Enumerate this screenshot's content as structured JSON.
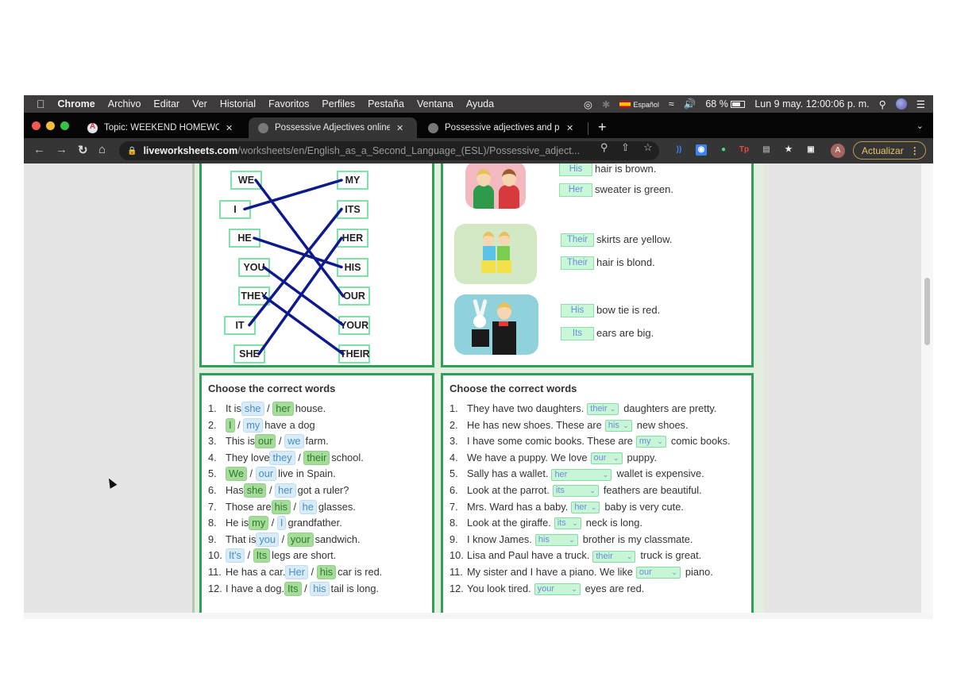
{
  "menubar": {
    "app": "Chrome",
    "items": [
      "Archivo",
      "Editar",
      "Ver",
      "Historial",
      "Favoritos",
      "Perfiles",
      "Pestaña",
      "Ventana",
      "Ayuda"
    ],
    "input_language": "Español",
    "battery": "68 %",
    "datetime": "Lun 9 may. 12:00:06 p. m."
  },
  "tabs": [
    {
      "title": "Topic: WEEKEND HOMEWORK",
      "active": false
    },
    {
      "title": "Possessive Adjectives online e",
      "active": true
    },
    {
      "title": "Possessive adjectives and pron",
      "active": false
    }
  ],
  "browser": {
    "url_host": "liveworksheets.com",
    "url_path": "/worksheets/en/English_as_a_Second_Language_(ESL)/Possessive_adject...",
    "update_label": "Actualizar",
    "avatar_initial": "A"
  },
  "matching": {
    "left": [
      "WE",
      "I",
      "HE",
      "YOU",
      "THEY",
      "IT",
      "SHE"
    ],
    "right": [
      "MY",
      "ITS",
      "HER",
      "HIS",
      "OUR",
      "YOUR",
      "THEIR"
    ],
    "pairs": [
      [
        "WE",
        "OUR"
      ],
      [
        "I",
        "MY"
      ],
      [
        "HE",
        "HIS"
      ],
      [
        "YOU",
        "YOUR"
      ],
      [
        "THEY",
        "THEIR"
      ],
      [
        "IT",
        "ITS"
      ],
      [
        "SHE",
        "HER"
      ]
    ],
    "line_color": "#0d1a8c"
  },
  "pictures": [
    {
      "answer": "His",
      "text": "hair is brown."
    },
    {
      "answer": "Her",
      "text": "sweater is green."
    },
    {
      "answer": "Their",
      "text": "skirts are yellow."
    },
    {
      "answer": "Their",
      "text": "hair is blond."
    },
    {
      "answer": "His",
      "text": "bow tie is red."
    },
    {
      "answer": "Its",
      "text": "ears are big."
    }
  ],
  "choose_left": {
    "title": "Choose the correct words",
    "items": [
      {
        "num": "1.",
        "pre": "It is",
        "a": "she",
        "a_sel": false,
        "b": "her",
        "b_sel": true,
        "post": "house."
      },
      {
        "num": "2.",
        "pre": "",
        "a": "I",
        "a_sel": true,
        "b": "my",
        "b_sel": false,
        "post": "have a dog"
      },
      {
        "num": "3.",
        "pre": "This is",
        "a": "our",
        "a_sel": true,
        "b": "we",
        "b_sel": false,
        "post": "farm."
      },
      {
        "num": "4.",
        "pre": "They love",
        "a": "they",
        "a_sel": false,
        "b": "their",
        "b_sel": true,
        "post": "school."
      },
      {
        "num": "5.",
        "pre": "",
        "a": "We",
        "a_sel": true,
        "b": "our",
        "b_sel": false,
        "post": "live in Spain."
      },
      {
        "num": "6.",
        "pre": "Has",
        "a": "she",
        "a_sel": true,
        "b": "her",
        "b_sel": false,
        "post": "got a ruler?"
      },
      {
        "num": "7.",
        "pre": "Those are",
        "a": "his",
        "a_sel": true,
        "b": "he",
        "b_sel": false,
        "post": "glasses."
      },
      {
        "num": "8.",
        "pre": "He is",
        "a": "my",
        "a_sel": true,
        "b": "I",
        "b_sel": false,
        "post": "grandfather."
      },
      {
        "num": "9.",
        "pre": "That is",
        "a": "you",
        "a_sel": false,
        "b": "your",
        "b_sel": true,
        "post": "sandwich."
      },
      {
        "num": "10.",
        "pre": "",
        "a": "It's",
        "a_sel": false,
        "b": "Its",
        "b_sel": true,
        "post": "legs are short."
      },
      {
        "num": "11.",
        "pre": "He has a car.",
        "a": "Her",
        "a_sel": false,
        "b": "his",
        "b_sel": true,
        "post": "car is red."
      },
      {
        "num": "12.",
        "pre": "I have a dog.",
        "a": "Its",
        "a_sel": true,
        "b": "his",
        "b_sel": false,
        "post": "tail is long."
      }
    ]
  },
  "choose_right": {
    "title": "Choose the correct words",
    "items": [
      {
        "num": "1.",
        "pre": "They have two daughters.",
        "value": "their",
        "post": "daughters are pretty."
      },
      {
        "num": "2.",
        "pre": "He has new shoes. These are",
        "value": "his",
        "post": "new shoes."
      },
      {
        "num": "3.",
        "pre": "I have some comic books. These are",
        "value": "my",
        "post": "comic books."
      },
      {
        "num": "4.",
        "pre": "We have a puppy. We love",
        "value": "our",
        "post": "puppy."
      },
      {
        "num": "5.",
        "pre": "Sally has a wallet.",
        "value": "her",
        "post": "wallet is expensive."
      },
      {
        "num": "6.",
        "pre": "Look at the parrot.",
        "value": "its",
        "post": "feathers are beautiful."
      },
      {
        "num": "7.",
        "pre": "Mrs. Ward has a baby.",
        "value": "her",
        "post": "baby is very cute."
      },
      {
        "num": "8.",
        "pre": "Look at the giraffe.",
        "value": "its",
        "post": "neck is long."
      },
      {
        "num": "9.",
        "pre": "I know James.",
        "value": "his",
        "post": "brother is my classmate."
      },
      {
        "num": "10.",
        "pre": "Lisa and Paul have a truck.",
        "value": "their",
        "post": "truck is great."
      },
      {
        "num": "11.",
        "pre": "My sister and I have a piano. We like",
        "value": "our",
        "post": "piano."
      },
      {
        "num": "12.",
        "pre": "You look tired.",
        "value": "your",
        "post": "eyes are red."
      }
    ]
  },
  "colors": {
    "panel_border": "#2e9e59",
    "word_box_border": "#7ee3a7",
    "selected_green": "#a5dc9a",
    "option_blue": "#d7ecf8",
    "floating_select": "#efa3a3"
  }
}
